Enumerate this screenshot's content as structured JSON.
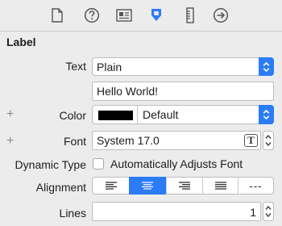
{
  "toolbar": {
    "icons": [
      "file-icon",
      "help-icon",
      "identity-icon",
      "attributes-icon",
      "size-icon",
      "connections-icon"
    ],
    "selected_index": 3,
    "accent": "#2b7cf6"
  },
  "section": {
    "title": "Label"
  },
  "text_row": {
    "label": "Text",
    "value": "Plain"
  },
  "text_field": {
    "value": "Hello World!"
  },
  "color_row": {
    "plus": "+",
    "label": "Color",
    "value": "Default",
    "swatch": "#000000"
  },
  "font_row": {
    "plus": "+",
    "label": "Font",
    "value": "System 17.0",
    "font_button": "T"
  },
  "dynamic_type": {
    "label": "Dynamic Type",
    "checkbox_label": "Automatically Adjusts Font",
    "checked": false
  },
  "alignment": {
    "label": "Alignment",
    "options": [
      "left",
      "center",
      "right",
      "justified",
      "natural"
    ],
    "selected": "center",
    "natural_text": "---"
  },
  "lines": {
    "label": "Lines",
    "value": "1"
  }
}
